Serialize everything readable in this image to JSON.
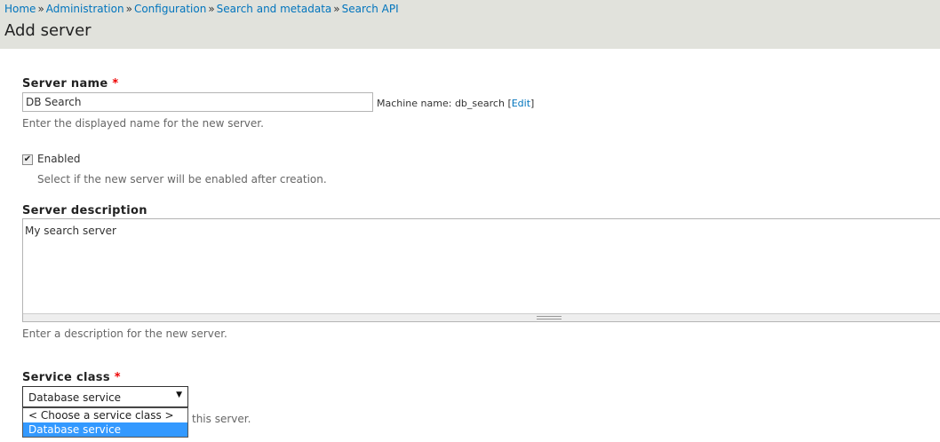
{
  "breadcrumb": {
    "items": [
      "Home",
      "Administration",
      "Configuration",
      "Search and metadata",
      "Search API"
    ],
    "separator": "»"
  },
  "page": {
    "title": "Add server"
  },
  "server_name": {
    "label": "Server name",
    "required_mark": "*",
    "value": "DB Search",
    "machine_name_prefix": "Machine name: db_search [",
    "machine_name_edit": "Edit",
    "machine_name_suffix": "]",
    "description": "Enter the displayed name for the new server."
  },
  "enabled": {
    "label": "Enabled",
    "checked": true,
    "description": "Select if the new server will be enabled after creation."
  },
  "server_description": {
    "label": "Server description",
    "value": "My search server",
    "description": "Enter a description for the new server."
  },
  "service_class": {
    "label": "Service class",
    "required_mark": "*",
    "selected": "Database service",
    "options": [
      "< Choose a service class >",
      "Database service"
    ],
    "description_visible": "this server."
  },
  "colors": {
    "header_bg": "#e1e2dc",
    "link": "#0074bd",
    "required": "#ee0000",
    "selection": "#3399ff"
  }
}
